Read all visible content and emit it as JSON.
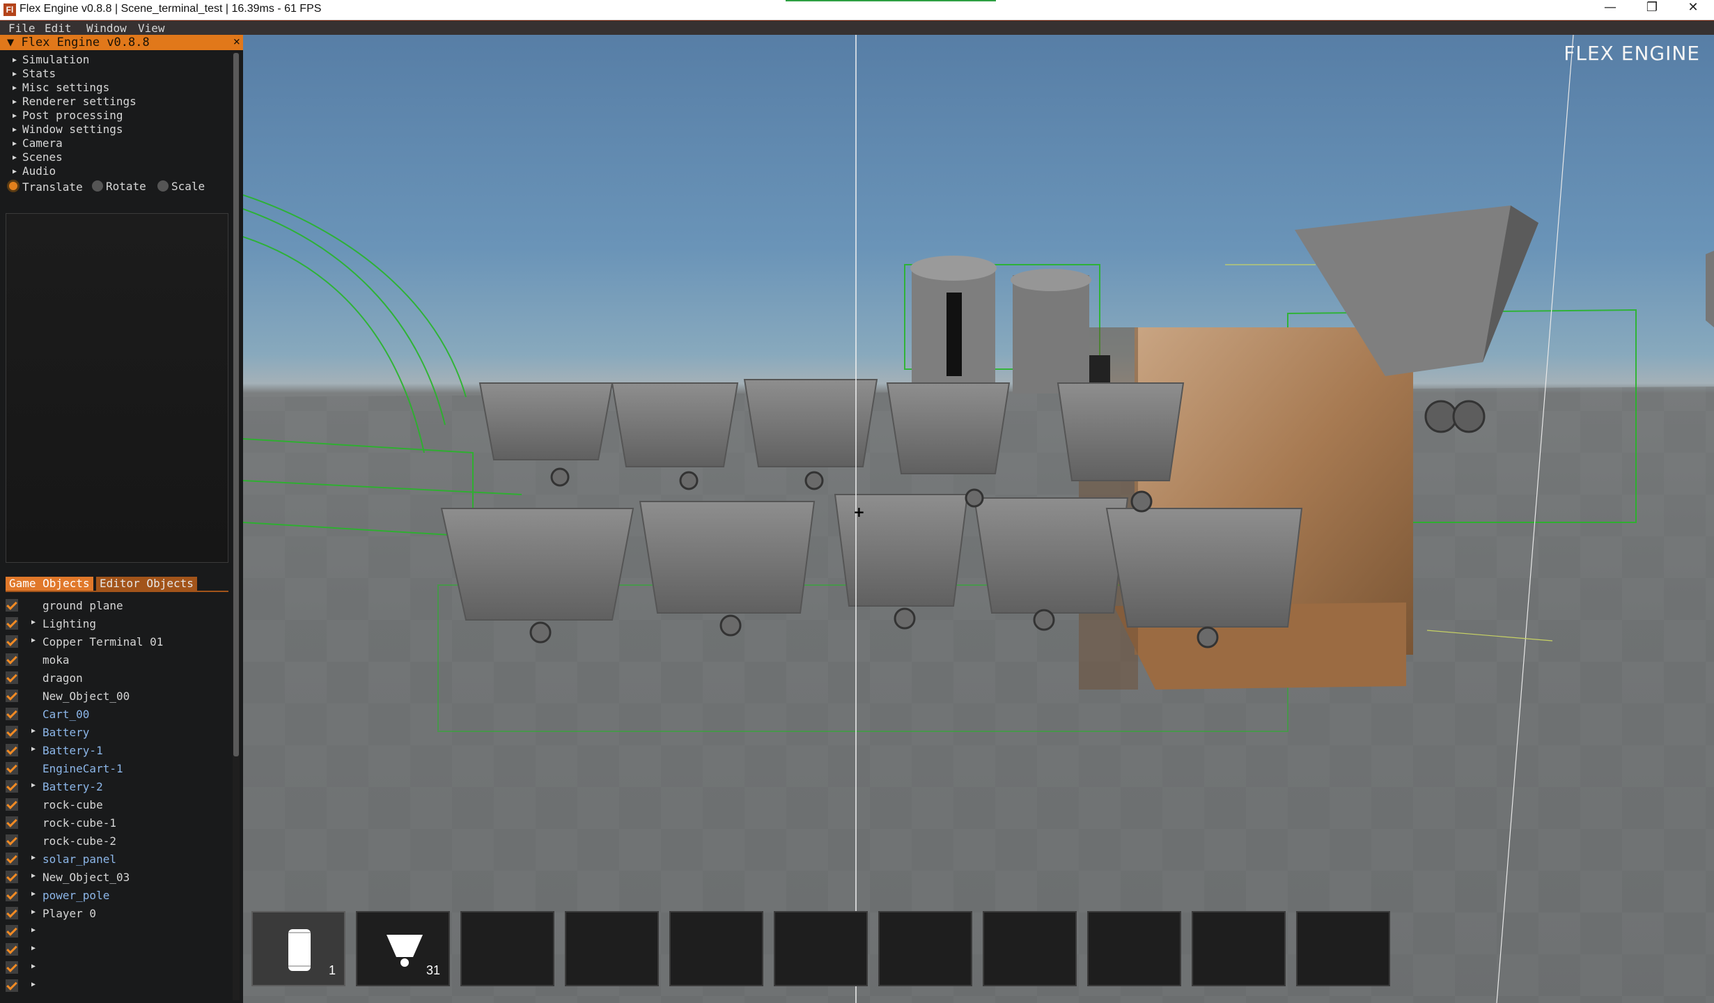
{
  "window": {
    "app_icon": "Fl",
    "title": "Flex Engine v0.8.8 | Scene_terminal_test | 16.39ms - 61 FPS",
    "controls": [
      "minimize-icon",
      "restore-icon",
      "close-icon"
    ]
  },
  "menubar": {
    "items": [
      "File",
      "Edit",
      "Window",
      "View"
    ]
  },
  "panel": {
    "title": "Flex Engine v0.8.8",
    "close": "×",
    "collapse_arrow": "▼",
    "sections": [
      "Simulation",
      "Stats",
      "Misc settings",
      "Renderer settings",
      "Post processing",
      "Window settings",
      "Camera",
      "Scenes",
      "Audio"
    ],
    "transform_modes": [
      "Translate",
      "Rotate",
      "Scale"
    ],
    "selected_mode": "Translate",
    "tabs": [
      "Game Objects",
      "Editor Objects"
    ],
    "active_tab": "Game Objects"
  },
  "objects": [
    {
      "name": "ground plane",
      "expandable": false,
      "highlighted": false
    },
    {
      "name": "Lighting",
      "expandable": true,
      "highlighted": false
    },
    {
      "name": "Copper Terminal 01",
      "expandable": true,
      "highlighted": false
    },
    {
      "name": "moka",
      "expandable": false,
      "highlighted": false
    },
    {
      "name": "dragon",
      "expandable": false,
      "highlighted": false
    },
    {
      "name": "New_Object_00",
      "expandable": false,
      "highlighted": false
    },
    {
      "name": "Cart_00",
      "expandable": false,
      "highlighted": true
    },
    {
      "name": "Battery",
      "expandable": true,
      "highlighted": true
    },
    {
      "name": "Battery-1",
      "expandable": true,
      "highlighted": true
    },
    {
      "name": "EngineCart-1",
      "expandable": false,
      "highlighted": true
    },
    {
      "name": "Battery-2",
      "expandable": true,
      "highlighted": true
    },
    {
      "name": "rock-cube",
      "expandable": false,
      "highlighted": false
    },
    {
      "name": "rock-cube-1",
      "expandable": false,
      "highlighted": false
    },
    {
      "name": "rock-cube-2",
      "expandable": false,
      "highlighted": false
    },
    {
      "name": "solar_panel",
      "expandable": true,
      "highlighted": true
    },
    {
      "name": "New_Object_03",
      "expandable": true,
      "highlighted": false
    },
    {
      "name": "power_pole",
      "expandable": true,
      "highlighted": true
    },
    {
      "name": "Player 0",
      "expandable": true,
      "highlighted": false
    },
    {
      "name": "",
      "expandable": true,
      "highlighted": false
    },
    {
      "name": "",
      "expandable": true,
      "highlighted": false
    },
    {
      "name": "",
      "expandable": true,
      "highlighted": false
    },
    {
      "name": "",
      "expandable": true,
      "highlighted": false
    }
  ],
  "viewport": {
    "brand": "FLEX ENGINE",
    "crosshair": "+"
  },
  "hotbar": [
    {
      "icon": "battery-icon",
      "count": "1",
      "selected": true
    },
    {
      "icon": "cart-icon",
      "count": "31",
      "selected": false
    },
    {
      "icon": "",
      "count": "",
      "selected": false
    },
    {
      "icon": "",
      "count": "",
      "selected": false
    },
    {
      "icon": "",
      "count": "",
      "selected": false
    },
    {
      "icon": "",
      "count": "",
      "selected": false
    },
    {
      "icon": "",
      "count": "",
      "selected": false
    },
    {
      "icon": "",
      "count": "",
      "selected": false
    },
    {
      "icon": "",
      "count": "",
      "selected": false
    },
    {
      "icon": "",
      "count": "",
      "selected": false
    },
    {
      "icon": "",
      "count": "",
      "selected": false
    }
  ],
  "colors": {
    "accent": "#e1781a",
    "checkbox": "#f08a24",
    "highlight_text": "#8cb6e8",
    "menubar_border": "#7a2a14"
  }
}
